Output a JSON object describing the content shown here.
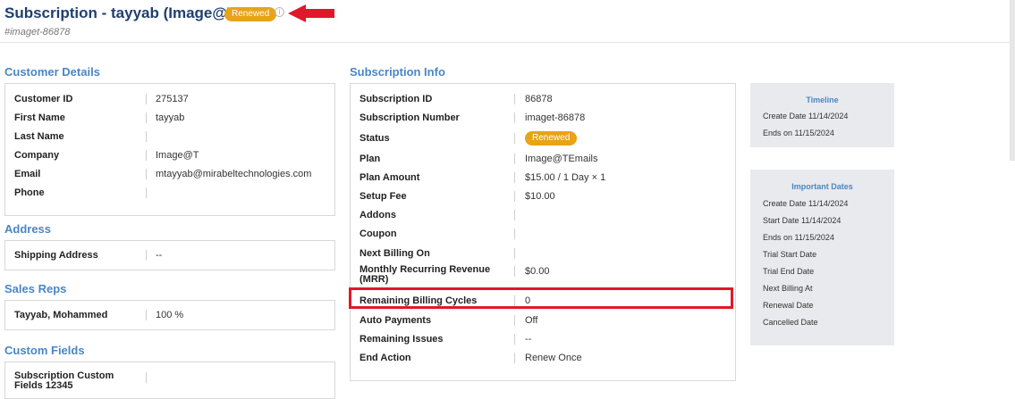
{
  "header": {
    "title": "Subscription - tayyab (Image@T)",
    "status_badge": "Renewed",
    "info_icon": "info-icon",
    "subtitle": "#imaget-86878",
    "annotation_color": "#e0182c"
  },
  "customer_details": {
    "title": "Customer Details",
    "rows": [
      {
        "label": "Customer ID",
        "value": "275137"
      },
      {
        "label": "First Name",
        "value": "tayyab"
      },
      {
        "label": "Last Name",
        "value": ""
      },
      {
        "label": "Company",
        "value": "Image@T"
      },
      {
        "label": "Email",
        "value": "mtayyab@mirabeltechnologies.com"
      },
      {
        "label": "Phone",
        "value": ""
      }
    ]
  },
  "address": {
    "title": "Address",
    "rows": [
      {
        "label": "Shipping Address",
        "value": "--"
      }
    ]
  },
  "sales_reps": {
    "title": "Sales Reps",
    "rows": [
      {
        "label": "Tayyab, Mohammed",
        "value": "100 %"
      }
    ]
  },
  "custom_fields": {
    "title": "Custom Fields",
    "rows": [
      {
        "label": "Subscription Custom Fields 12345",
        "value": ""
      }
    ]
  },
  "subscription_info": {
    "title": "Subscription Info",
    "status_badge": "Renewed",
    "rows": [
      {
        "label": "Subscription ID",
        "value": "86878"
      },
      {
        "label": "Subscription Number",
        "value": "imaget-86878"
      },
      {
        "label": "Status",
        "value": ""
      },
      {
        "label": "Plan",
        "value": "Image@TEmails"
      },
      {
        "label": "Plan Amount",
        "value": "$15.00 / 1 Day × 1"
      },
      {
        "label": "Setup Fee",
        "value": "$10.00"
      },
      {
        "label": "Addons",
        "value": ""
      },
      {
        "label": "Coupon",
        "value": ""
      },
      {
        "label": "Next Billing On",
        "value": ""
      },
      {
        "label": "Monthly Recurring Revenue (MRR)",
        "value": "$0.00"
      },
      {
        "label": "Remaining Billing Cycles",
        "value": "0"
      },
      {
        "label": "Auto Payments",
        "value": "Off"
      },
      {
        "label": "Remaining Issues",
        "value": "--"
      },
      {
        "label": "End Action",
        "value": "Renew Once"
      }
    ]
  },
  "timeline": {
    "title": "Timeline",
    "lines": [
      "Create Date 11/14/2024",
      "Ends on 11/15/2024"
    ]
  },
  "important_dates": {
    "title": "Important Dates",
    "lines": [
      "Create Date 11/14/2024",
      "Start Date 11/14/2024",
      "Ends on 11/15/2024",
      "Trial Start Date",
      "Trial End Date",
      "Next Billing At",
      "Renewal Date",
      "Cancelled Date"
    ]
  }
}
